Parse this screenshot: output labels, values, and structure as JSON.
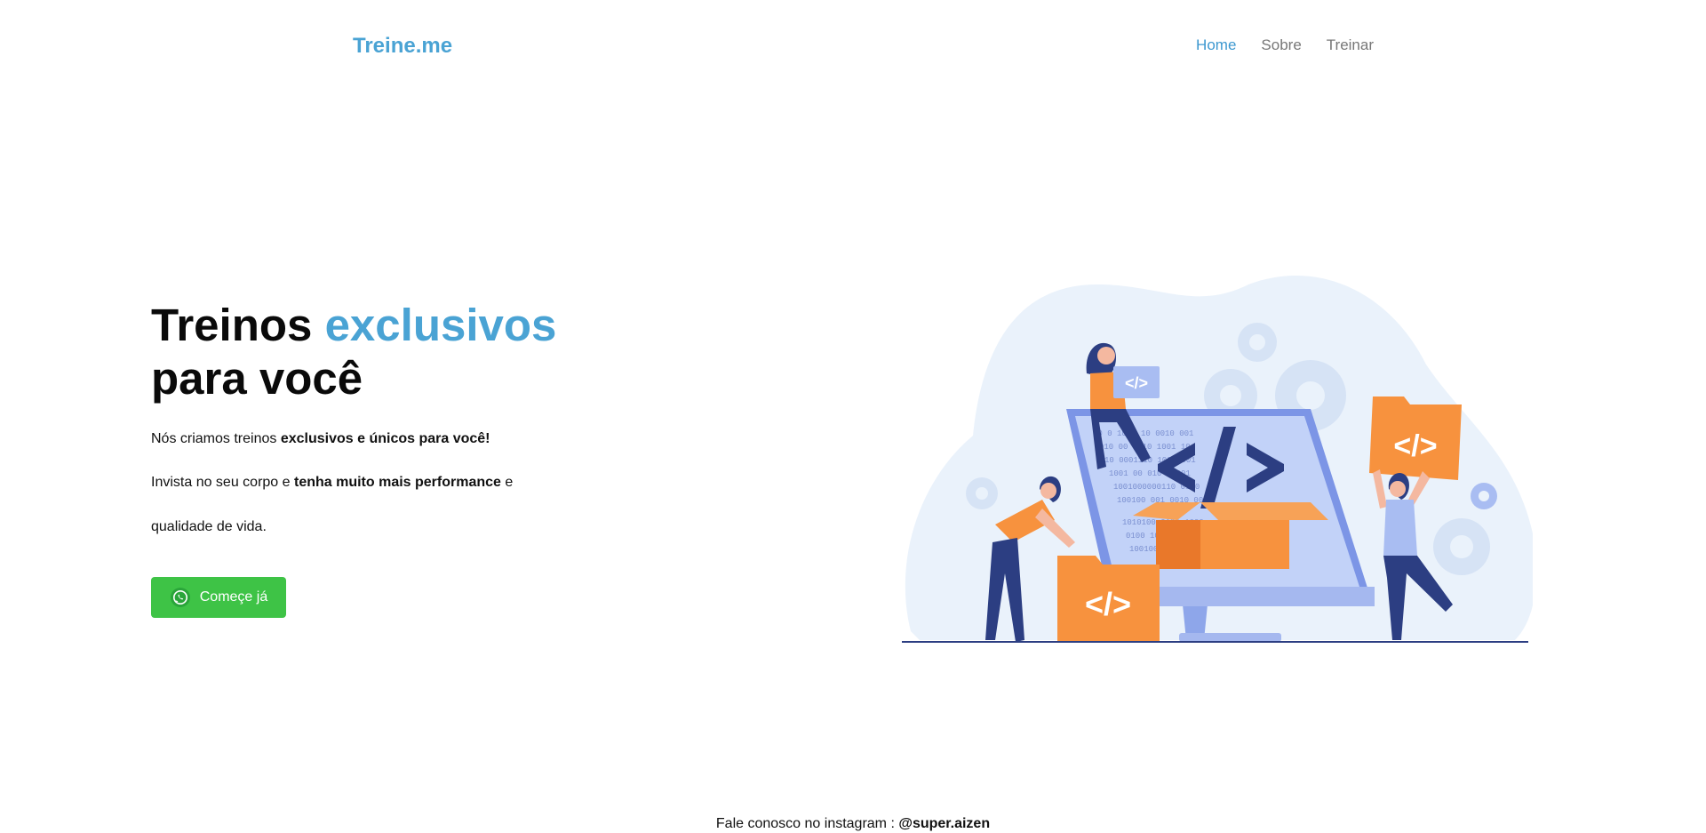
{
  "header": {
    "logo": "Treine.me",
    "nav": [
      {
        "label": "Home",
        "active": true
      },
      {
        "label": "Sobre",
        "active": false
      },
      {
        "label": "Treinar",
        "active": false
      }
    ]
  },
  "hero": {
    "title_part1": "Treinos ",
    "title_accent": "exclusivos",
    "title_part2": "para você",
    "line1_pre": "Nós criamos treinos ",
    "line1_bold": "exclusivos e únicos para você!",
    "line2_pre": "Invista no seu corpo e ",
    "line2_bold": "tenha muito mais performance",
    "line2_post": " e",
    "line3": "qualidade de vida.",
    "cta_label": "Começe já"
  },
  "footer": {
    "text": "Fale conosco no instagram : ",
    "handle": "@super.aizen"
  },
  "colors": {
    "brand": "#4aa3d4",
    "cta": "#3ec346",
    "orange": "#f7923e",
    "navy": "#2c3e82"
  },
  "icons": {
    "cta_icon": "whatsapp-icon"
  }
}
